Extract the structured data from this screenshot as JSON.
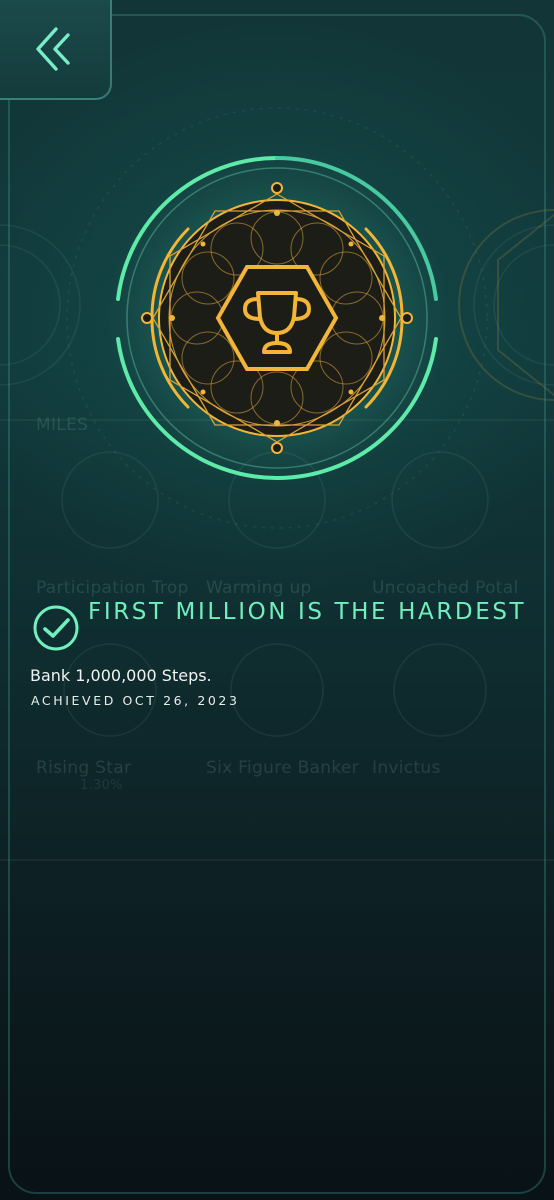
{
  "achievement": {
    "title": "FIRST MILLION IS THE HARDEST",
    "description": "Bank 1,000,000 Steps.",
    "achieved": "ACHIEVED OCT 26, 2023",
    "status": "completed",
    "badge_icon": "trophy-icon"
  },
  "background_badges": [
    {
      "name": "Participation Trop",
      "percent": ""
    },
    {
      "name": "Warming up",
      "percent": ""
    },
    {
      "name": "Uncoached Potal",
      "percent": ""
    },
    {
      "name": "Rising Star",
      "percent": "1.30%"
    },
    {
      "name": "Six Figure Banker",
      "percent": ""
    },
    {
      "name": "Invictus",
      "percent": ""
    }
  ],
  "background_section_label": "MILES",
  "colors": {
    "accent_green": "#6ff0bc",
    "ring_green": "#5eeaa8",
    "badge_gold": "#f2b537",
    "badge_dark": "#1d1d17",
    "background": "#11393b"
  },
  "icons": {
    "back": "double-chevron-left-icon",
    "check": "check-circle-icon"
  }
}
